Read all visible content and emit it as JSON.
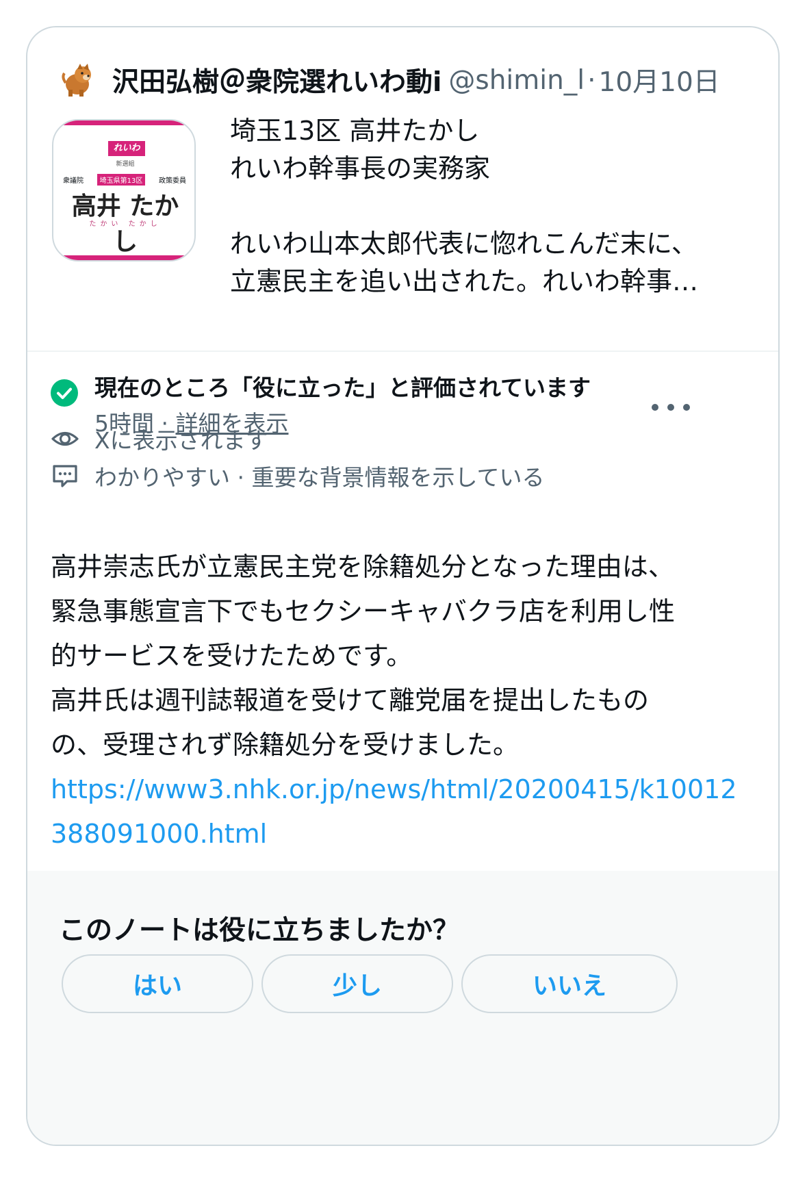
{
  "post": {
    "author_name": "沢田弘樹＠衆院選れいわ動i",
    "author_handle": "@shimin_l",
    "separator": "·",
    "date": "10月10日",
    "thumbnail": {
      "logo": "れいわ",
      "sub": "新選組",
      "left_label": "衆議院",
      "badge": "埼玉県第13区",
      "right_label": "政策委員",
      "name": "高井 たかし",
      "kana": "たかい たかし"
    },
    "text_lines": [
      "埼玉13区 高井たかし",
      "れいわ幹事長の実務家",
      "れいわ山本太郎代表に惚れこんだ末に、",
      "立憲民主を追い出された。れいわ幹事…"
    ]
  },
  "note": {
    "status": "現在のところ「役に立った」と評価されています",
    "time": "5時間",
    "meta_separator": " · ",
    "details_link": "詳細を表示",
    "visibility": "Xに表示されます",
    "reasons": "わかりやすい · 重要な背景情報を示している",
    "body_lines": [
      "高井崇志氏が立憲民主党を除籍処分となった理由は、",
      "緊急事態宣言下でもセクシーキャバクラ店を利用し性",
      "的サービスを受けたためです。",
      "高井氏は週刊誌報道を受けて離党届を提出したもの",
      "の、受理されず除籍処分を受けました。"
    ],
    "link": "https://www3.nhk.or.jp/news/html/20200415/k10012388091000.html"
  },
  "rating": {
    "question": "このノートは役に立ちましたか？",
    "yes": "はい",
    "somewhat": "少し",
    "no": "いいえ"
  },
  "colors": {
    "accent": "#1d9bf0",
    "success": "#00ba7c",
    "secondary_text": "#536471",
    "brand_pink": "#d6237a"
  }
}
